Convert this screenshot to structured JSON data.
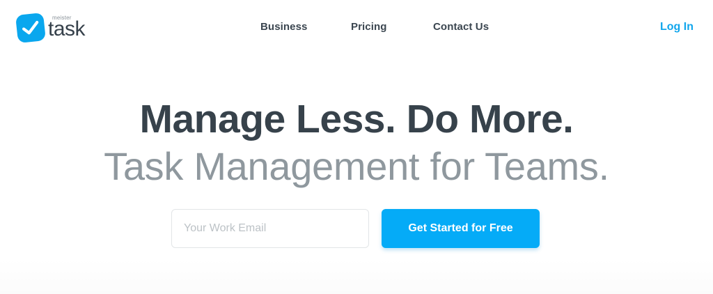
{
  "brand": {
    "sub_label": "meister",
    "name": "task",
    "accent_color": "#0aa7ee",
    "icon": "checkmark-icon"
  },
  "nav": {
    "items": [
      {
        "label": "Business"
      },
      {
        "label": "Pricing"
      },
      {
        "label": "Contact Us"
      }
    ],
    "login_label": "Log In"
  },
  "hero": {
    "title": "Manage Less. Do More.",
    "subtitle": "Task Management for Teams."
  },
  "signup": {
    "email_placeholder": "Your Work Email",
    "email_value": "",
    "cta_label": "Get Started for Free",
    "cta_color": "#05abf7"
  }
}
